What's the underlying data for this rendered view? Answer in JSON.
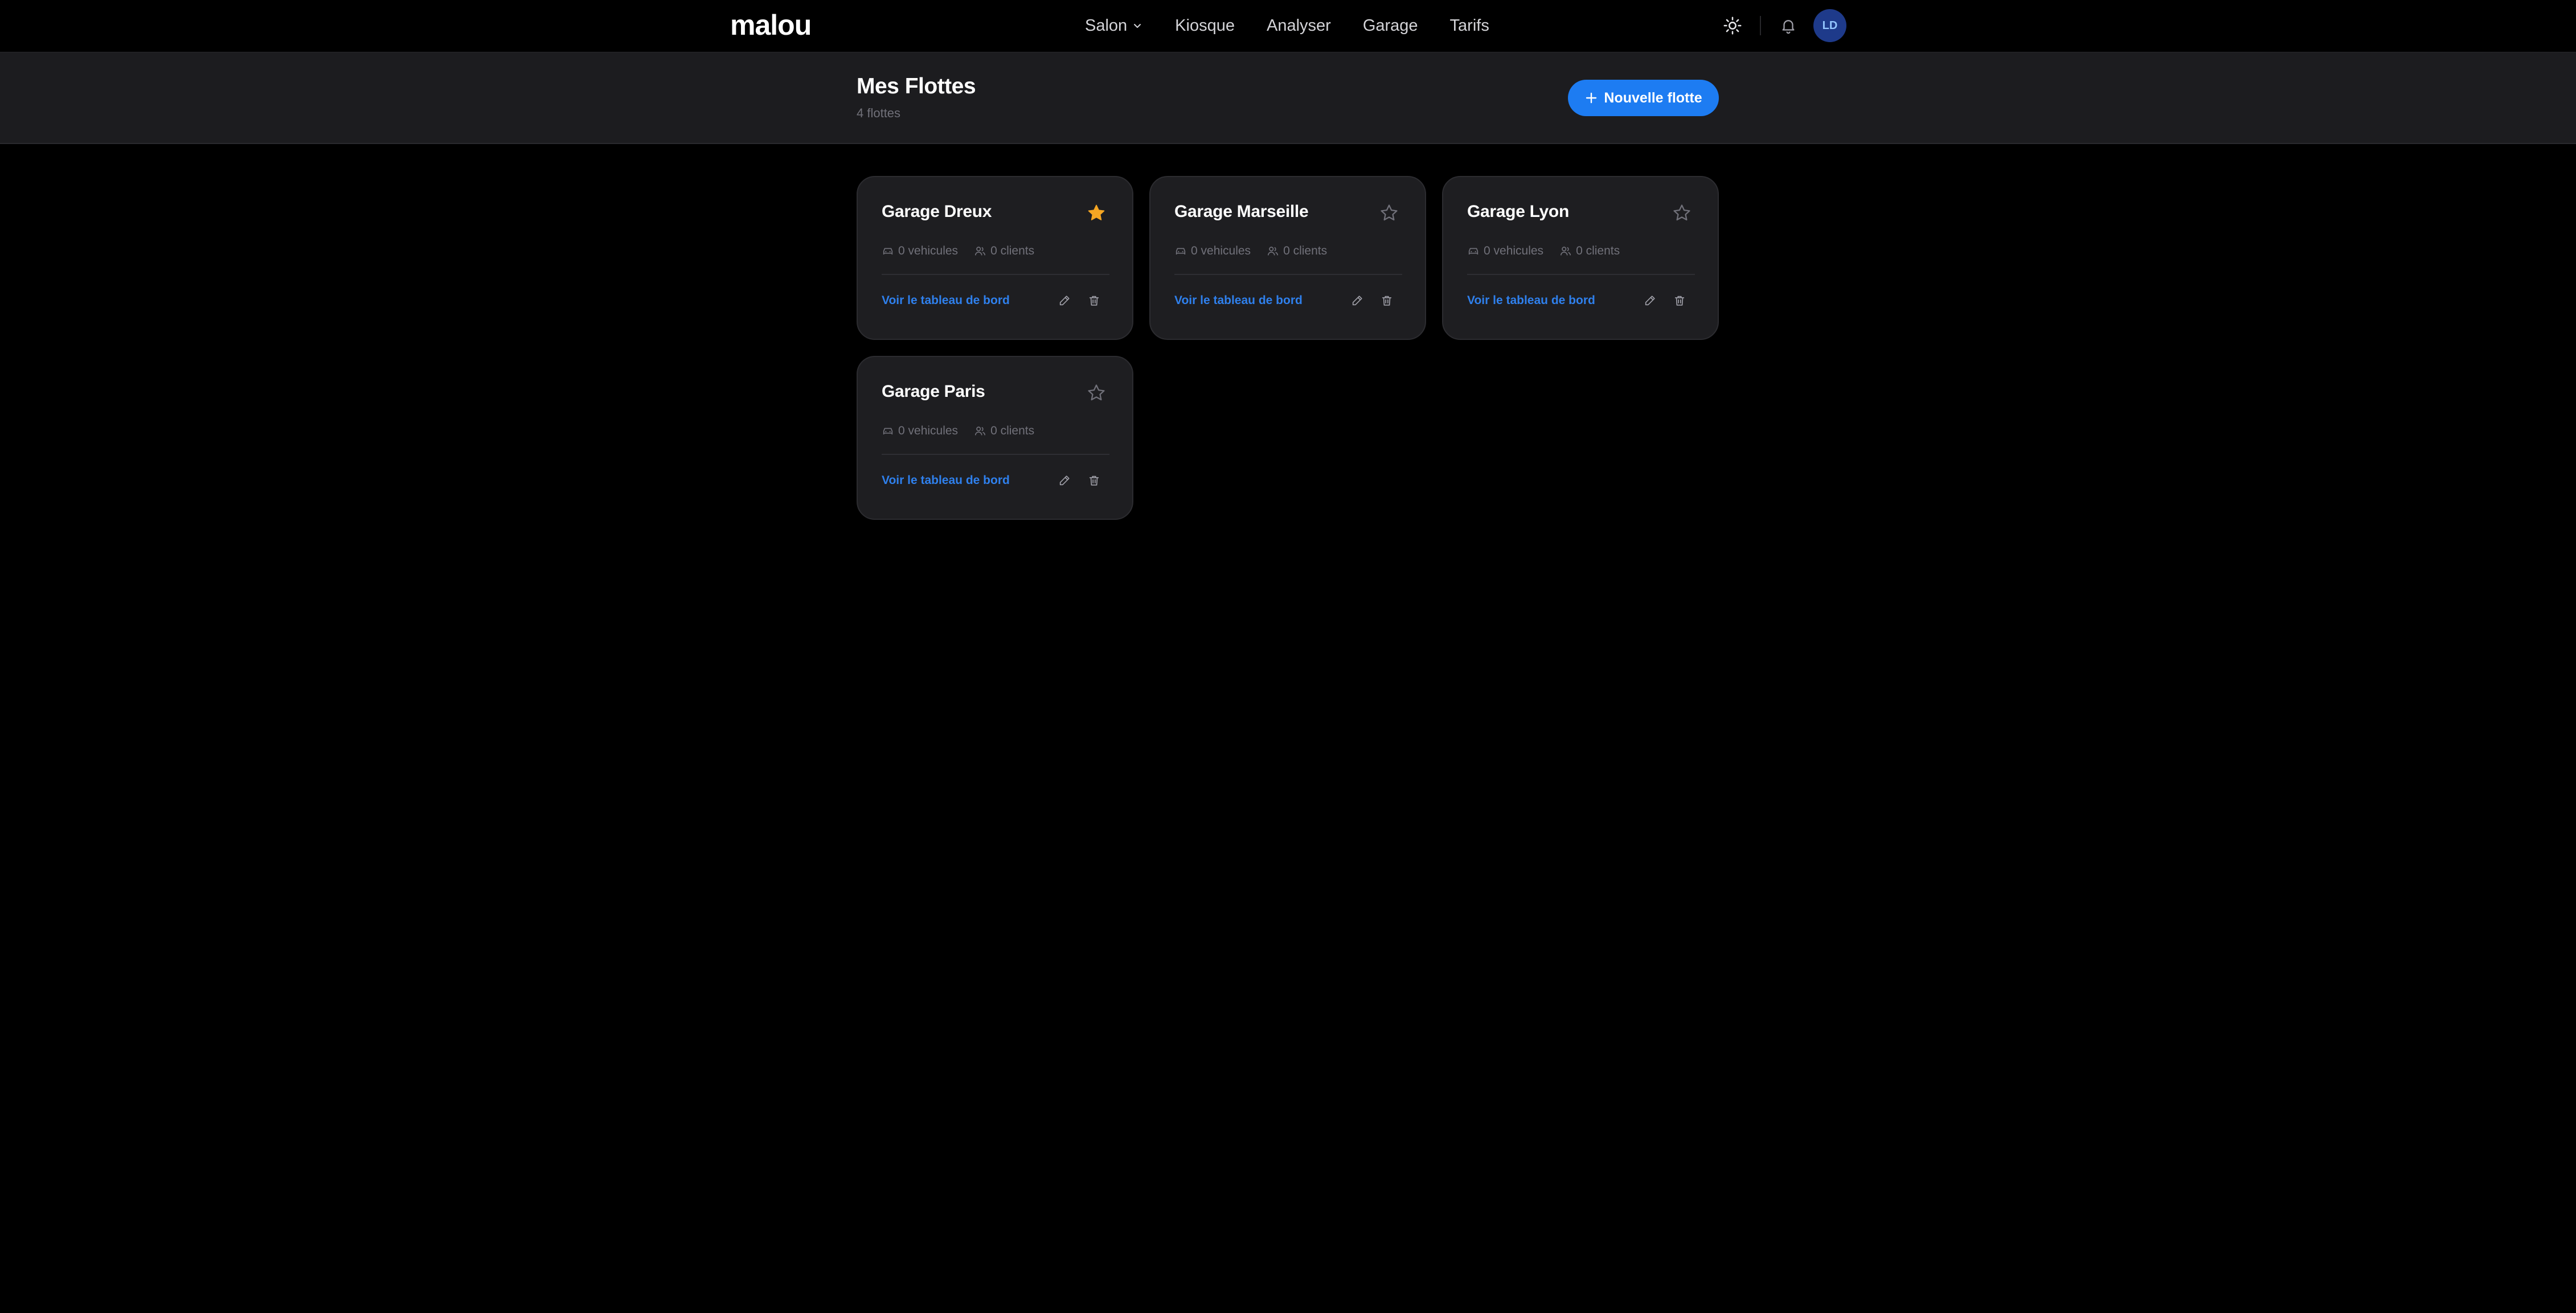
{
  "app": {
    "logo": "malou"
  },
  "nav": {
    "items": [
      {
        "label": "Salon",
        "has_dropdown": true
      },
      {
        "label": "Kiosque"
      },
      {
        "label": "Analyser"
      },
      {
        "label": "Garage"
      },
      {
        "label": "Tarifs"
      }
    ],
    "right": {
      "theme_icon": "sun-icon",
      "notification_icon": "bell-icon",
      "avatar_initials": "LD"
    }
  },
  "header": {
    "title": "Mes Flottes",
    "subtitle": "4 flottes",
    "new_button_label": "Nouvelle flotte"
  },
  "fleets": [
    {
      "name": "Garage Dreux",
      "favorite": true,
      "vehicles": "0 vehicules",
      "clients": "0 clients",
      "link": "Voir le tableau de bord"
    },
    {
      "name": "Garage Marseille",
      "favorite": false,
      "vehicles": "0 vehicules",
      "clients": "0 clients",
      "link": "Voir le tableau de bord"
    },
    {
      "name": "Garage Lyon",
      "favorite": false,
      "vehicles": "0 vehicules",
      "clients": "0 clients",
      "link": "Voir le tableau de bord"
    },
    {
      "name": "Garage Paris",
      "favorite": false,
      "vehicles": "0 vehicules",
      "clients": "0 clients",
      "link": "Voir le tableau de bord"
    }
  ],
  "colors": {
    "accent": "#1d7cf2",
    "link": "#2f80ed",
    "star_active": "#f5a623",
    "star_inactive": "#71717a",
    "background": "#000000",
    "card": "#1e1e21"
  }
}
